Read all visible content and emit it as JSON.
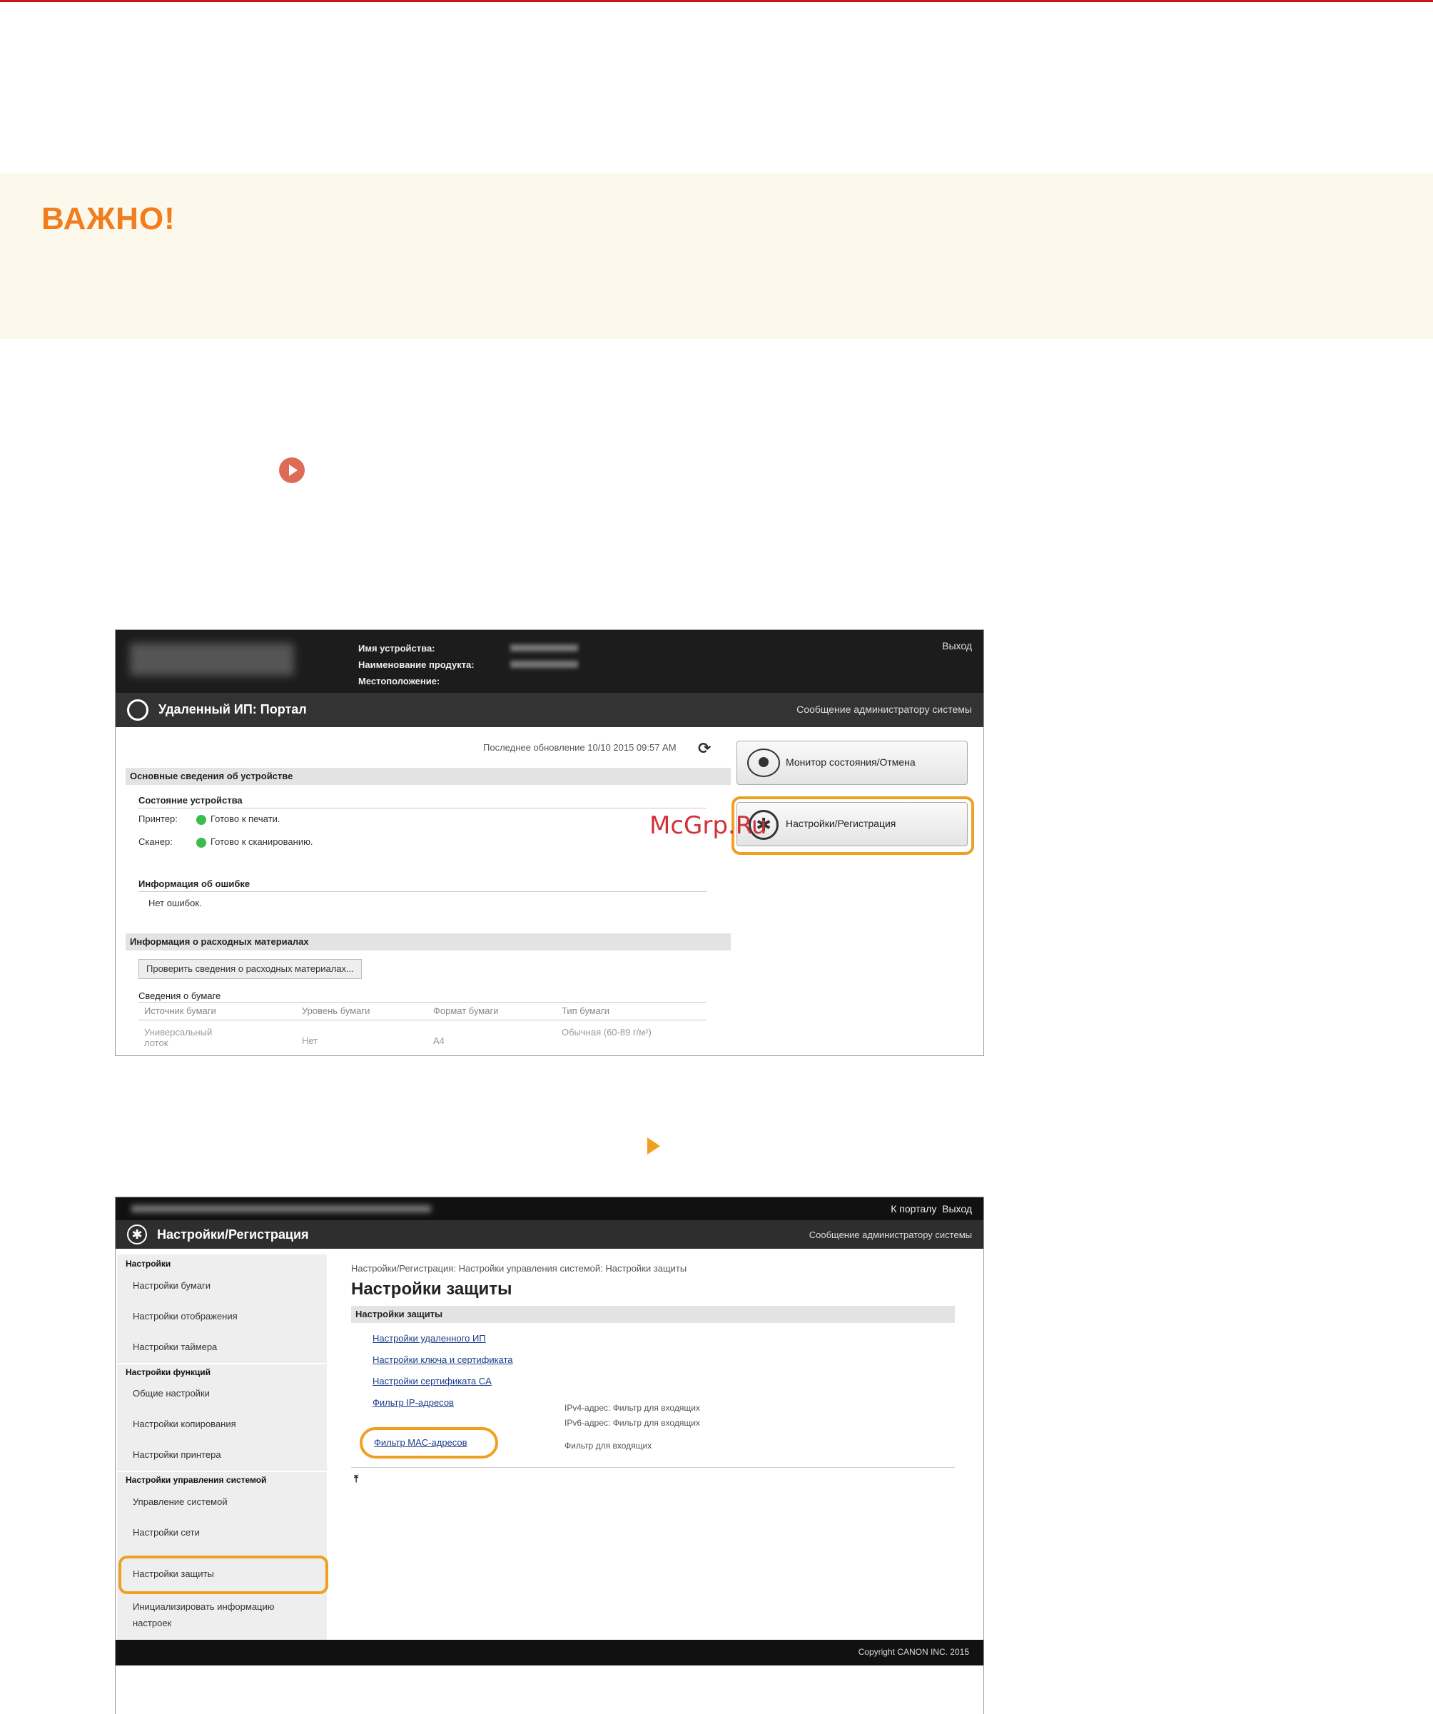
{
  "important": {
    "title": "ВАЖНО!"
  },
  "watermark": "McGrp.Ru",
  "portal": {
    "header": {
      "device_name_label": "Имя устройства:",
      "product_name_label": "Наименование продукта:",
      "location_label": "Местоположение:",
      "logout": "Выход"
    },
    "title": "Удаленный ИП: Портал",
    "admin_message": "Сообщение администратору системы",
    "last_updated": "Последнее обновление 10/10 2015 09:57 AM",
    "basic_info": {
      "heading": "Основные сведения об устройстве",
      "status_heading": "Состояние устройства",
      "printer_label": "Принтер:",
      "printer_status": "Готово к печати.",
      "scanner_label": "Сканер:",
      "scanner_status": "Готово к сканированию."
    },
    "error_info": {
      "heading": "Информация об ошибке",
      "text": "Нет ошибок."
    },
    "consumables": {
      "heading": "Информация о расходных материалах",
      "check_button": "Проверить сведения о расходных материалах...",
      "paper_heading": "Сведения о бумаге",
      "columns": [
        "Источник бумаги",
        "Уровень бумаги",
        "Формат бумаги",
        "Тип бумаги"
      ],
      "row": [
        "Универсальный лоток",
        "Нет",
        "A4",
        "Обычная (60-89 г/м²)"
      ]
    },
    "side_buttons": {
      "status_monitor": "Монитор состояния/Отмена",
      "settings": "Настройки/Регистрация"
    }
  },
  "settings_page": {
    "top_links": {
      "portal": "К порталу",
      "logout": "Выход"
    },
    "title": "Настройки/Регистрация",
    "admin_message": "Сообщение администратору системы",
    "sidebar": {
      "group1": "Настройки",
      "group1_items": [
        "Настройки бумаги",
        "Настройки отображения",
        "Настройки таймера"
      ],
      "group2": "Настройки функций",
      "group2_items": [
        "Общие настройки",
        "Настройки копирования",
        "Настройки принтера"
      ],
      "group3": "Настройки управления системой",
      "group3_items": [
        "Управление системой",
        "Настройки сети",
        "Настройки защиты"
      ],
      "init_item_line1": "Инициализировать информацию",
      "init_item_line2": "настроек"
    },
    "breadcrumb": "Настройки/Регистрация: Настройки управления системой: Настройки защиты",
    "page_title": "Настройки защиты",
    "section_heading": "Настройки защиты",
    "links": [
      "Настройки удаленного ИП",
      "Настройки ключа и сертификата",
      "Настройки сертификата CA",
      "Фильтр IP-адресов",
      "Фильтр MAC-адресов"
    ],
    "ip_filter_desc1": "IPv4-адрес: Фильтр для входящих",
    "ip_filter_desc2": "IPv6-адрес: Фильтр для входящих",
    "mac_filter_desc": "Фильтр для входящих",
    "copyright": "Copyright CANON INC. 2015"
  }
}
